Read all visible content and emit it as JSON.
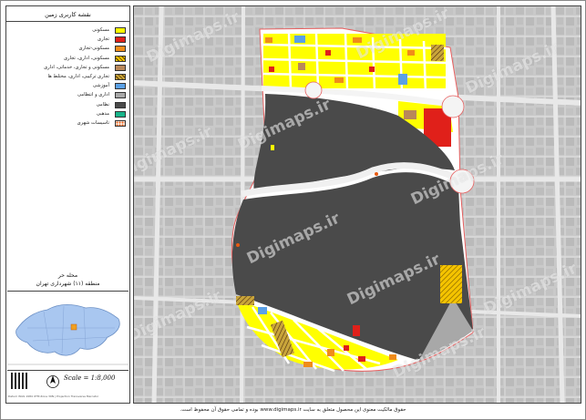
{
  "legend": {
    "title": "نقشه کاربری زمین",
    "items": [
      {
        "label": "مسکونی",
        "color": "#ffff00"
      },
      {
        "label": "تجاری",
        "color": "#e0201a"
      },
      {
        "label": "مسکونی-تجاری",
        "color": "#f08c1a"
      },
      {
        "label": "مسکونی، اداری، تجاری",
        "color": "#f5c400",
        "hatch": true
      },
      {
        "label": "مسکونی و تجاری، خدماتی، اداری",
        "color": "#b9875a"
      },
      {
        "label": "تجاری ترکیبی، اداری، مختلط ها",
        "color": "#c9a53a",
        "hatch": true
      },
      {
        "label": "آموزشی",
        "color": "#5aa0e6"
      },
      {
        "label": "اداری و انتظامی",
        "color": "#a8a8a8"
      },
      {
        "label": "نظامی",
        "color": "#4a4a4a"
      },
      {
        "label": "مذهبی",
        "color": "#18b48a"
      },
      {
        "label": "تاسیسات شهری",
        "color": "#e85a10",
        "dotted": true
      }
    ],
    "area_title": "محله حر",
    "area_subtitle": "منطقه (۱۱) شهرداری تهران",
    "scale": "Scale = 1:8,000",
    "north": "N",
    "footer": "Datum WGS 1984 UTM Zone 39N   |   Projection Transverse Mercator"
  },
  "map": {
    "watermark": "Digimaps.ir"
  },
  "copyright": "حقوق مالکیت معنوی این محصول متعلق به سایت www.digimaps.ir بوده و تمامی حقوق آن محفوظ است."
}
